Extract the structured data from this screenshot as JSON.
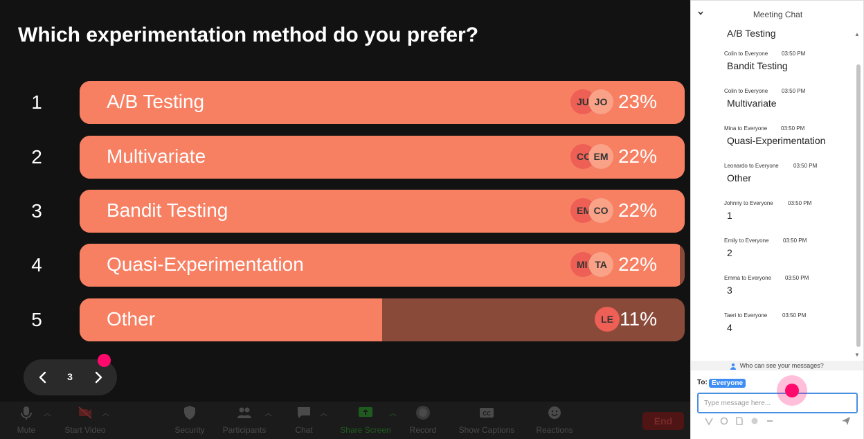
{
  "poll": {
    "question": "Which experimentation method do you prefer?",
    "options": [
      {
        "number": "1",
        "label": "A/B Testing",
        "percent": "23%",
        "fill": 1.0,
        "avatars": [
          "JU",
          "JO"
        ]
      },
      {
        "number": "2",
        "label": "Multivariate",
        "percent": "22%",
        "fill": 1.0,
        "avatars": [
          "CO",
          "EM"
        ]
      },
      {
        "number": "3",
        "label": "Bandit Testing",
        "percent": "22%",
        "fill": 1.0,
        "avatars": [
          "EM",
          "CO"
        ]
      },
      {
        "number": "4",
        "label": "Quasi-Experimentation",
        "percent": "22%",
        "fill": 0.992,
        "avatars": [
          "MI",
          "TA"
        ]
      },
      {
        "number": "5",
        "label": "Other",
        "percent": "11%",
        "fill": 0.5,
        "avatars": [
          "LE"
        ]
      }
    ]
  },
  "slide_nav": {
    "prev_icon": "chevron-left-icon",
    "page": "3",
    "next_icon": "chevron-right-icon"
  },
  "toolbar": {
    "mute": "Mute",
    "start_video": "Start Video",
    "security": "Security",
    "participants": "Participants",
    "chat": "Chat",
    "share_screen": "Share Screen",
    "record": "Record",
    "show_captions": "Show Captions",
    "reactions": "Reactions",
    "end": "End"
  },
  "chat": {
    "title": "Meeting Chat",
    "first_text": "A/B Testing",
    "messages": [
      {
        "sender": "Colin to Everyone",
        "time": "03:50 PM",
        "text": "Bandit Testing"
      },
      {
        "sender": "Colin to Everyone",
        "time": "03:50 PM",
        "text": "Multivariate"
      },
      {
        "sender": "Mina to Everyone",
        "time": "03:50 PM",
        "text": "Quasi-Experimentation"
      },
      {
        "sender": "Leonardo to Everyone",
        "time": "03:50 PM",
        "text": "Other"
      },
      {
        "sender": "Johnny to Everyone",
        "time": "03:50 PM",
        "text": "1"
      },
      {
        "sender": "Emily to Everyone",
        "time": "03:50 PM",
        "text": "2"
      },
      {
        "sender": "Emma to Everyone",
        "time": "03:50 PM",
        "text": "3"
      },
      {
        "sender": "Taeri to Everyone",
        "time": "03:50 PM",
        "text": "4"
      }
    ],
    "visibility_note": "Who can see your messages?",
    "to_label": "To:",
    "recipient": "Everyone",
    "input_placeholder": "Type message here..."
  },
  "colors": {
    "bar_fill": "#f77f62",
    "bar_track": "#8a4a3a",
    "stage_bg": "#121212",
    "accent_pink": "#ff0a6c",
    "recipient_badge": "#3d8df5"
  }
}
